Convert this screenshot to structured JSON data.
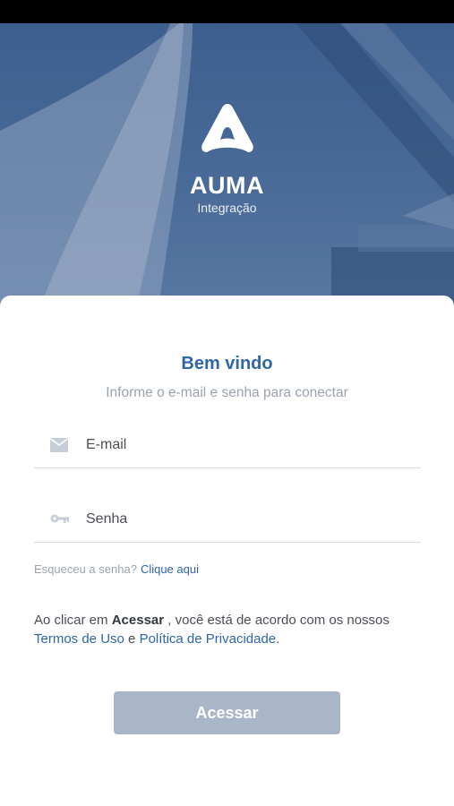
{
  "brand": {
    "name": "AUMA",
    "subtitle": "Integração"
  },
  "login": {
    "title": "Bem vindo",
    "subtitle": "Informe o e-mail e senha para conectar",
    "email_placeholder": "E-mail",
    "password_placeholder": "Senha",
    "forgot_question": "Esqueceu a senha?",
    "forgot_link": "Clique aqui",
    "terms": {
      "prefix": "Ao clicar em ",
      "action_word": "Acessar",
      "middle": " , você está de acordo com os nossos ",
      "terms_link": "Termos de Uso",
      "conjunction": " e ",
      "privacy_link": "Política de Privacidade."
    },
    "submit_label": "Acessar"
  },
  "colors": {
    "accent": "#2f66a8",
    "button_disabled": "#a9b6c7",
    "hero_overlay": "#46669a"
  },
  "icons": {
    "logo": "auma-logo-icon",
    "email": "mail-icon",
    "password": "key-icon"
  }
}
